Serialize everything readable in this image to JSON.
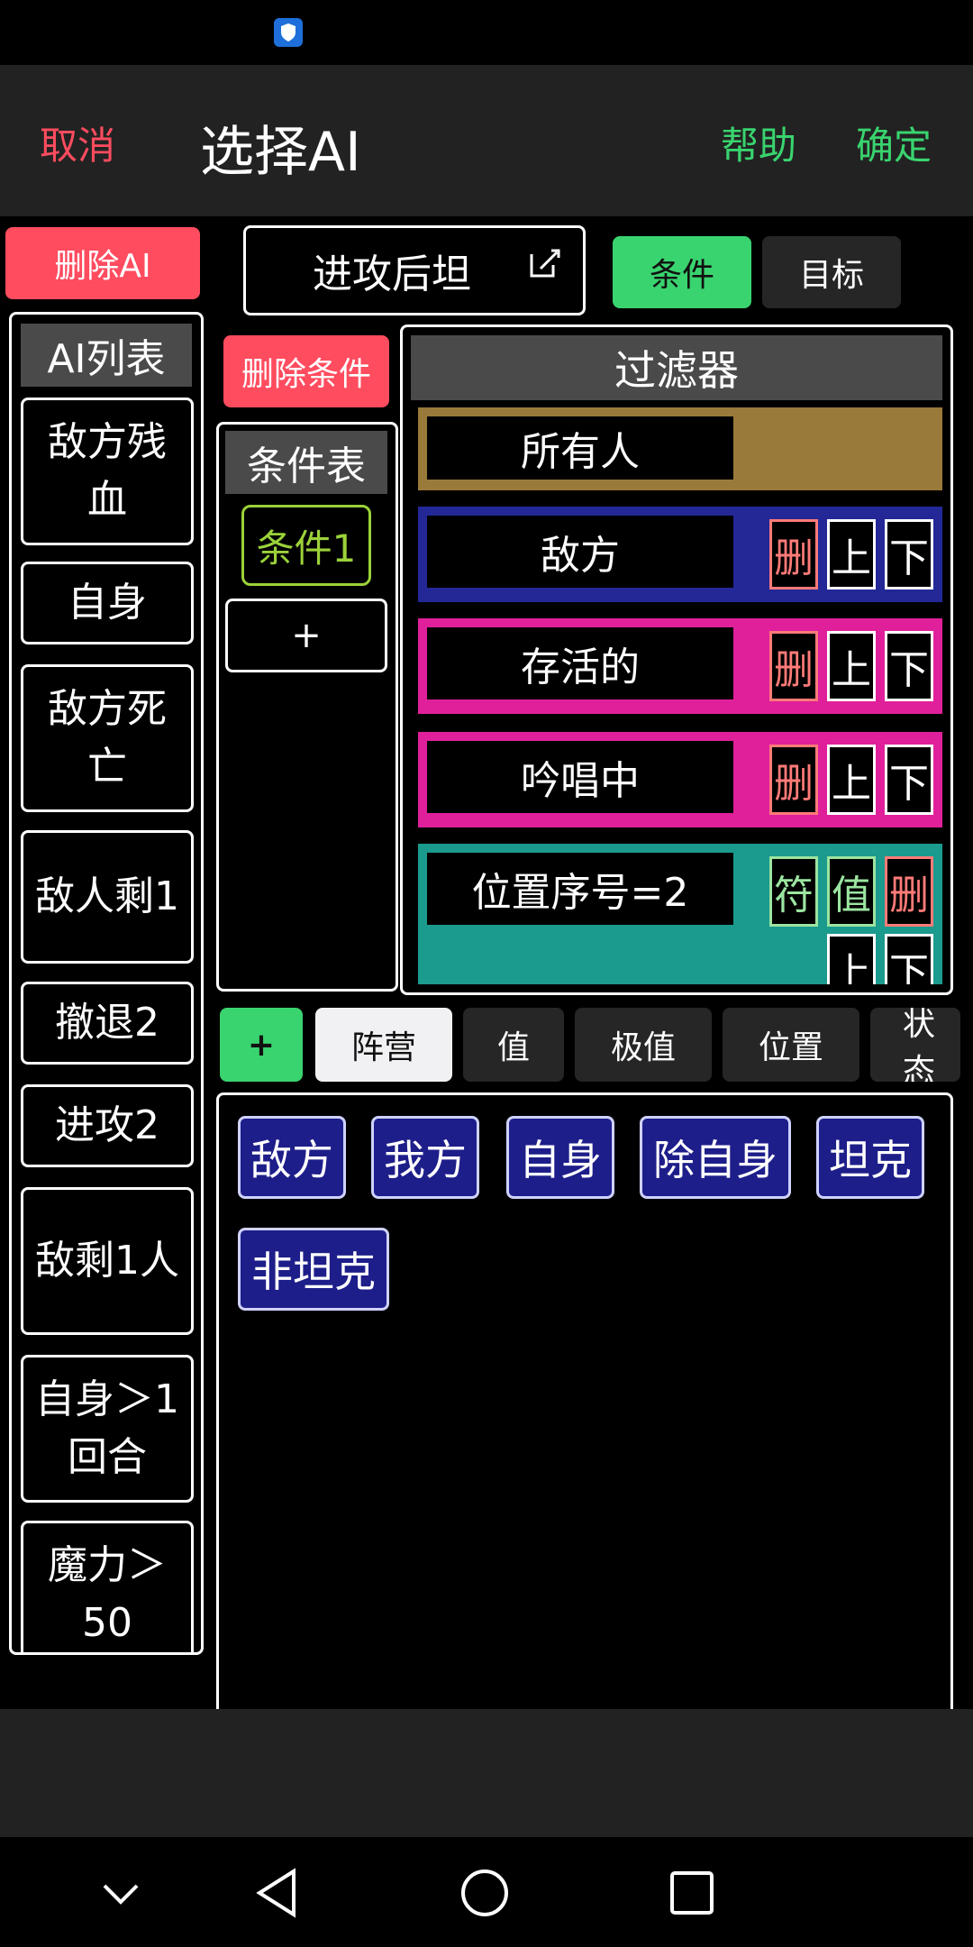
{
  "header": {
    "cancel": "取消",
    "title": "选择AI",
    "help": "帮助",
    "confirm": "确定"
  },
  "left": {
    "delete_ai": "删除AI",
    "list_title": "AI列表",
    "items": [
      "敌方残血",
      "自身",
      "敌方死亡",
      "敌人剩1",
      "撤退2",
      "进攻2",
      "敌剩1人",
      "自身＞1回合",
      "魔力＞50"
    ]
  },
  "editor": {
    "ai_name": "进攻后坦",
    "tabs": {
      "condition": "条件",
      "target": "目标"
    }
  },
  "conditions": {
    "delete_label": "删除条件",
    "title": "条件表",
    "items": [
      "条件1"
    ],
    "add_label": "+"
  },
  "filter": {
    "title": "过滤器",
    "rows": [
      {
        "label": "所有人",
        "color": "#9a7a3a"
      },
      {
        "label": "敌方",
        "color": "#232896",
        "del": "删",
        "up": "上",
        "down": "下"
      },
      {
        "label": "存活的",
        "color": "#e0209b",
        "del": "删",
        "up": "上",
        "down": "下"
      },
      {
        "label": "吟唱中",
        "color": "#e0209b",
        "del": "删",
        "up": "上",
        "down": "下"
      },
      {
        "label": "位置序号=2",
        "color": "#1b9a8e",
        "sym": "符",
        "val": "值",
        "del": "删",
        "up": "上",
        "down": "下"
      }
    ]
  },
  "categories": {
    "add": "+",
    "tabs": [
      "阵营",
      "值",
      "极值",
      "位置",
      "状态"
    ],
    "active": "阵营"
  },
  "options": [
    "敌方",
    "我方",
    "自身",
    "除自身",
    "坦克",
    "非坦克"
  ],
  "colors": {
    "accent_green": "#39d46f",
    "danger_red": "#ff4c5f",
    "condition_green": "#9bd23a",
    "option_blue": "#1e1e8a"
  }
}
